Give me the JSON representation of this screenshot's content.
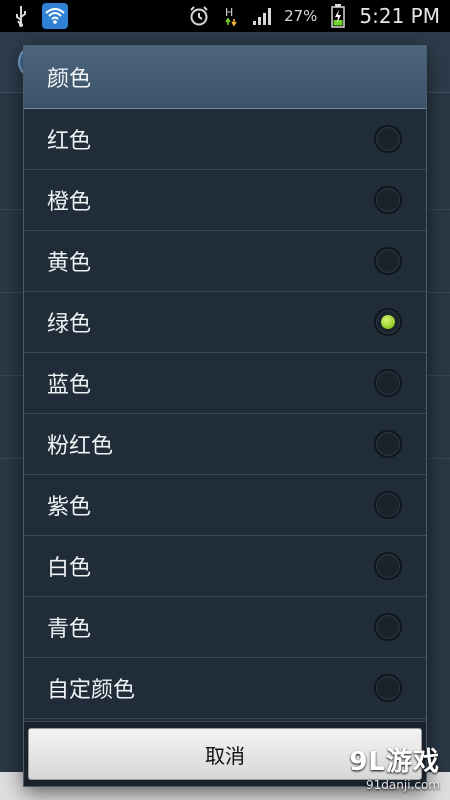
{
  "status_bar": {
    "icons": [
      "usb-icon",
      "wifi-icon",
      "alarm-icon",
      "data-h-icon",
      "signal-icon",
      "battery-charging-icon"
    ],
    "network": "H",
    "battery": "27%",
    "time": "5:21 PM"
  },
  "dialog": {
    "title": "颜色",
    "options": [
      {
        "label": "红色",
        "selected": false
      },
      {
        "label": "橙色",
        "selected": false
      },
      {
        "label": "黄色",
        "selected": false
      },
      {
        "label": "绿色",
        "selected": true
      },
      {
        "label": "蓝色",
        "selected": false
      },
      {
        "label": "粉红色",
        "selected": false
      },
      {
        "label": "紫色",
        "selected": false
      },
      {
        "label": "白色",
        "selected": false
      },
      {
        "label": "青色",
        "selected": false
      },
      {
        "label": "自定颜色",
        "selected": false
      }
    ],
    "cancel_label": "取消"
  },
  "colors": {
    "dialog_bg": "#202c38",
    "title_bg": "#4e667d",
    "radio_selected": "#9ad12c"
  },
  "watermark": {
    "main": "9L游戏",
    "sub": "91danji.com"
  }
}
